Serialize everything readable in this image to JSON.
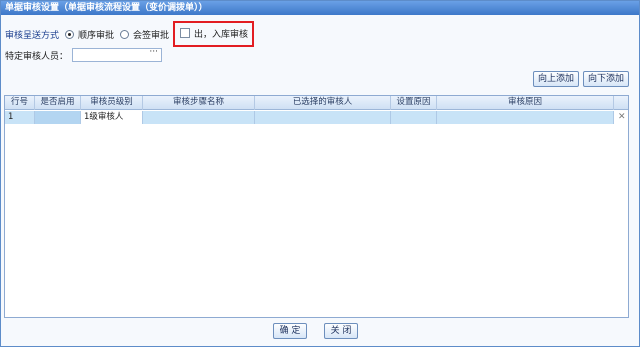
{
  "window": {
    "title": "单据审核设置（单据审核流程设置（变价调拨单））"
  },
  "form": {
    "send_mode_label": "审核呈送方式",
    "radio_sequential": "顺序审批",
    "radio_countersign": "会签审批",
    "checkbox_inout_label": "出，入库审核",
    "reviewer_label": "特定审核人员：",
    "lookup_dots": "···"
  },
  "toolbar": {
    "add_up": "向上添加",
    "add_down": "向下添加"
  },
  "table": {
    "columns": [
      "行号",
      "是否启用",
      "审核员级别",
      "审核步骤名称",
      "已选择的审核人",
      "设置原因",
      "审核原因"
    ],
    "rows": [
      {
        "row_no": "1",
        "enabled": "",
        "level": "1级审核人",
        "step_name": "",
        "selected_reviewer": "",
        "set_reason": "",
        "review_reason": ""
      }
    ],
    "delete_symbol": "✕"
  },
  "footer": {
    "ok": "确 定",
    "close": "关 闭"
  }
}
